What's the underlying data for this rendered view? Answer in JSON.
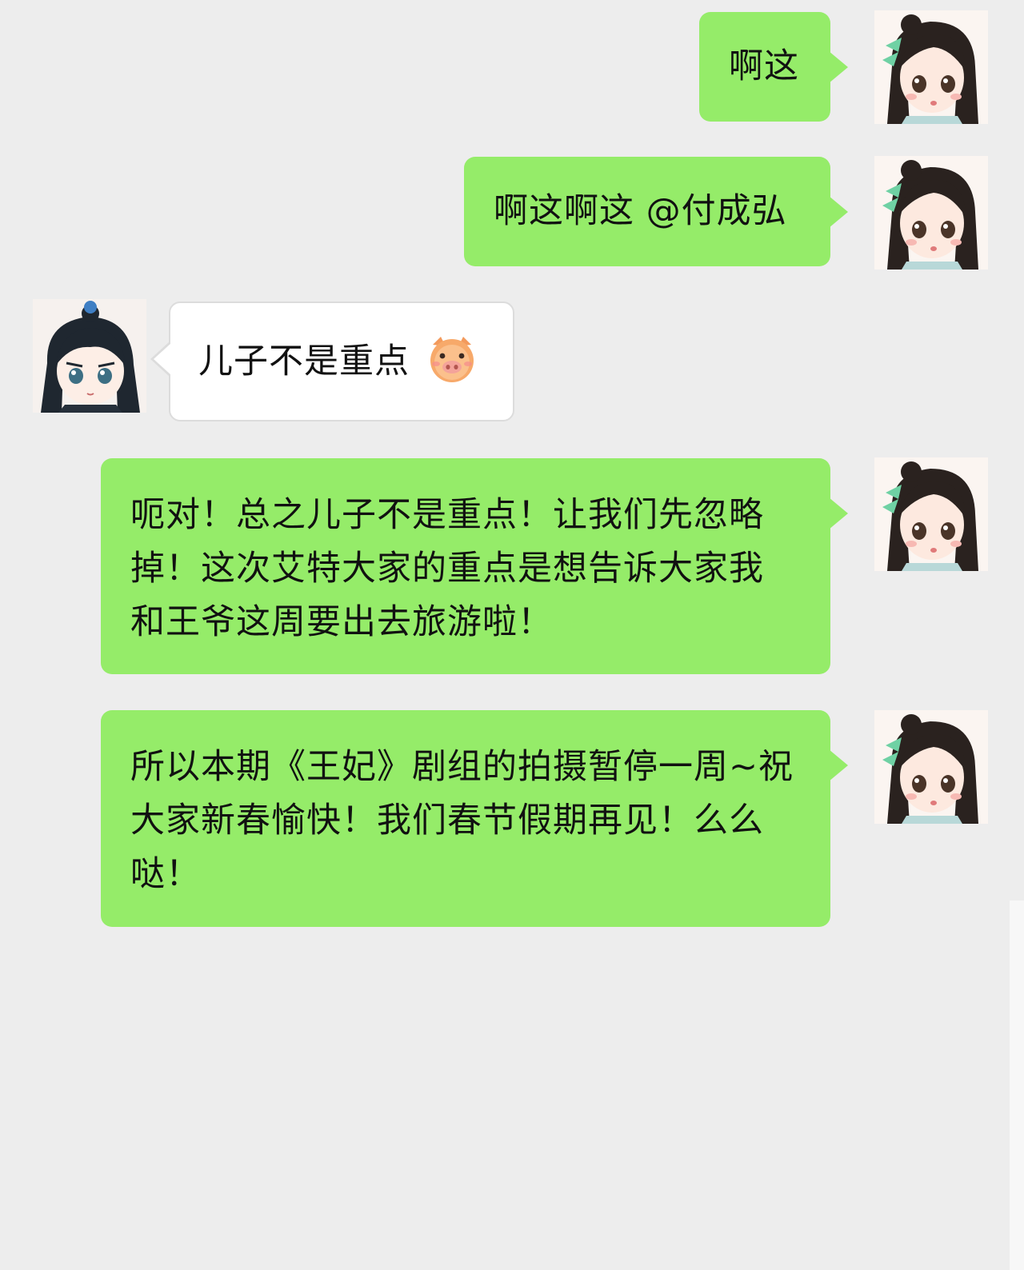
{
  "conversation": {
    "messages": [
      {
        "sender": "me",
        "text": "啊这"
      },
      {
        "sender": "me",
        "text": "啊这啊这 @付成弘"
      },
      {
        "sender": "other",
        "text": "儿子不是重点",
        "emoji": "pig-face"
      },
      {
        "sender": "me",
        "text": "呃对！总之儿子不是重点！让我们先忽略掉！这次艾特大家的重点是想告诉大家我和王爷这周要出去旅游啦！"
      },
      {
        "sender": "me",
        "text": "所以本期《王妃》剧组的拍摄暂停一周~祝大家新春愉快！我们春节假期再见！么么哒！"
      }
    ]
  },
  "colors": {
    "background": "#ededed",
    "my_bubble": "#95ec69",
    "other_bubble": "#ffffff",
    "text": "#111111"
  },
  "icons": {
    "my_avatar": "girl-avatar-icon",
    "other_avatar": "boy-avatar-icon",
    "emoji": "pig-face-icon"
  }
}
